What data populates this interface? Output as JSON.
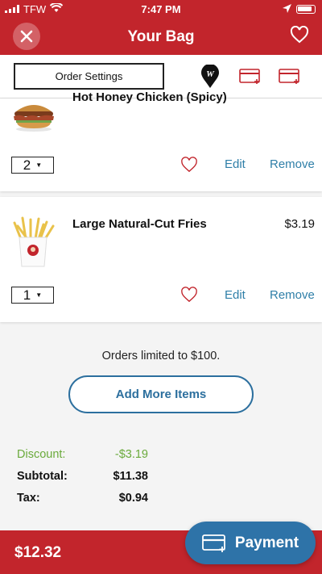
{
  "status_bar": {
    "carrier": "TFW",
    "time": "7:47 PM"
  },
  "header": {
    "title": "Your Bag"
  },
  "toolbar": {
    "order_settings_label": "Order Settings",
    "pin_letter": "W"
  },
  "items": [
    {
      "name": "Hot Honey Chicken (Spicy)",
      "quantity": "2",
      "edit_label": "Edit",
      "remove_label": "Remove"
    },
    {
      "name": "Large Natural-Cut Fries",
      "price": "$3.19",
      "quantity": "1",
      "edit_label": "Edit",
      "remove_label": "Remove"
    }
  ],
  "limit_notice": "Orders limited to $100.",
  "add_more_label": "Add More Items",
  "summary": {
    "discount_label": "Discount:",
    "discount_value": "-$3.19",
    "subtotal_label": "Subtotal:",
    "subtotal_value": "$11.38",
    "tax_label": "Tax:",
    "tax_value": "$0.94"
  },
  "footer": {
    "total": "$12.32",
    "payment_label": "Payment"
  },
  "colors": {
    "brand_red": "#c2252c",
    "action_blue": "#2e73a8",
    "discount_green": "#6aaa3b",
    "link_blue": "#2f7fa8"
  }
}
